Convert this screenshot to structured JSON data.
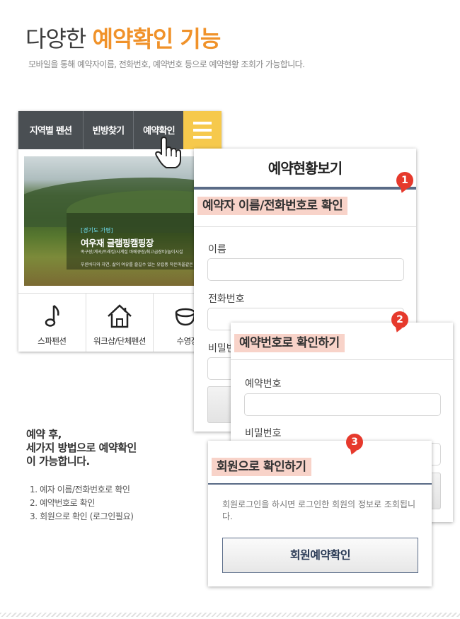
{
  "header": {
    "title_plain": "다양한 ",
    "title_highlight": "예약확인 기능",
    "subtitle": "모바일을 통해 예약자이름, 전화번호, 예약번호 등으로 예약현황 조회가 가능합니다."
  },
  "phone": {
    "nav": [
      "지역별 펜션",
      "빈방찾기",
      "예약확인"
    ],
    "hero": {
      "region": "[경기도 가평]",
      "name": "여우재 글램핑캠핑장",
      "desc1": "족구장/계곡/트래킹/사계절 바베큐장/최고급장비/놀이시설",
      "desc2": "푸른바다와 자연, 삶의 여유를 즐길수 있는 유럽풍 작은마을같은 펜션"
    },
    "tiles": [
      "스파펜션",
      "워크샵/단체펜션",
      "수영장"
    ]
  },
  "panel1": {
    "title": "예약현황보기",
    "badge": "1",
    "section": "예약자 이름/전화번호로 확인",
    "name_label": "이름",
    "phone_label": "전화번호",
    "pw_label": "비밀번호"
  },
  "panel2": {
    "badge": "2",
    "section": "예약번호로 확인하기",
    "number_label": "예약번호",
    "pw_label": "비밀번호"
  },
  "panel3": {
    "badge": "3",
    "section": "회원으로 확인하기",
    "description": "회원로그인을 하시면 로그인한 회원의 정보로 조회됩니다.",
    "button": "회원예약확인"
  },
  "summary": {
    "line1": "예약 후,",
    "line2": "세가지 방법으로 예약확인",
    "line3": "이 가능합니다.",
    "steps": [
      "1. 예자 이름/전화번호로 확인",
      "2. 예약번호로 확인",
      "3. 회원으로 확인 (로그인필요)"
    ]
  },
  "colors": {
    "accent": "#f0922a",
    "nav_bg": "#4a4f53",
    "menu_bg": "#f6c94c",
    "badge": "#e6392c",
    "section_bg": "#f8d3c9",
    "panel_rule": "#5a6b86"
  },
  "icons": [
    "menu-icon",
    "hand-pointer-icon",
    "music-note-icon",
    "house-icon",
    "bowl-icon"
  ]
}
